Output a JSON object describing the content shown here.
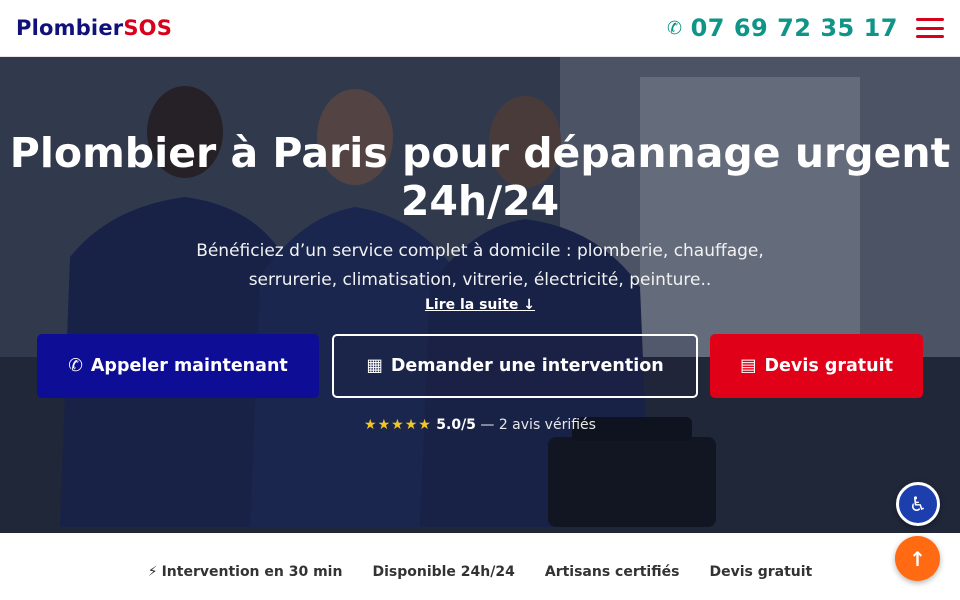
{
  "header": {
    "logo_part1": "Plombier",
    "logo_part2": "SOS",
    "phone_icon": "phone-icon",
    "phone": "07 69 72 35 17",
    "menu_icon": "hamburger-menu-icon"
  },
  "hero": {
    "title": "Plombier à Paris pour dépannage urgent 24h/24",
    "subtitle": "Bénéficiez d’un service complet à domicile : plomberie, chauffage, serrurerie, climatisation, vitrerie, électricité, peinture..",
    "read_more": "Lire la suite ↓",
    "buttons": {
      "call": {
        "icon": "phone-icon",
        "label": "Appeler maintenant"
      },
      "intervention": {
        "icon": "calendar-icon",
        "label": "Demander une intervention"
      },
      "quote": {
        "icon": "document-icon",
        "label": "Devis gratuit"
      }
    },
    "rating": {
      "stars": "★★★★★",
      "score": "5.0/5",
      "separator": "—",
      "reviews": "2 avis vérifiés"
    }
  },
  "features": [
    {
      "icon": "⚡",
      "label": "Intervention en 30 min"
    },
    {
      "icon": "",
      "label": "Disponible 24h/24"
    },
    {
      "icon": "",
      "label": "Artisans certifiés"
    },
    {
      "icon": "",
      "label": "Devis gratuit"
    }
  ],
  "floating": {
    "accessibility_icon": "accessibility-icon",
    "scroll_top_icon": "arrow-up-icon"
  },
  "colors": {
    "brand_navy": "#10127a",
    "brand_red": "#d9001b",
    "phone_teal": "#0f9488",
    "call_button": "#0d0d96",
    "quote_button": "#e00018",
    "scroll_top": "#ff6a13",
    "accessibility": "#1d3fae"
  }
}
